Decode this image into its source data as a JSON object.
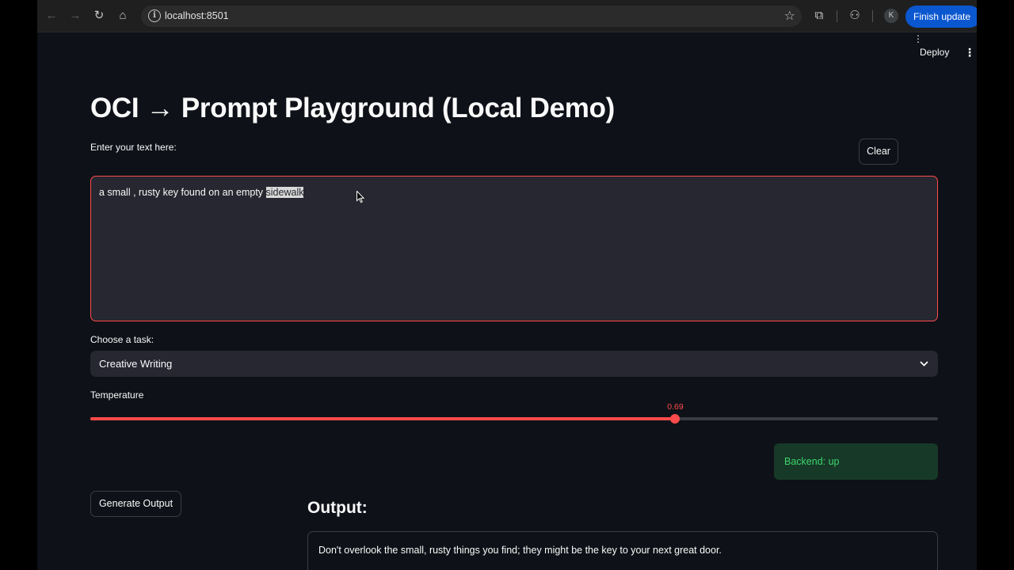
{
  "browser": {
    "url": "localhost:8501",
    "profile_initial": "K",
    "finish_update_label": "Finish update"
  },
  "app": {
    "deploy_label": "Deploy",
    "title": "OCI → Prompt Playground (Local Demo)",
    "input_label": "Enter your text here:",
    "clear_label": "Clear",
    "input_text_before": "a small , rusty key found on an empty ",
    "input_text_selected": "sidewalk",
    "task_label": "Choose a task:",
    "task_selected": "Creative Writing",
    "temperature_label": "Temperature",
    "temperature_value": "0.69",
    "temperature_fraction": 0.69,
    "backend_status": "Backend: up",
    "generate_label": "Generate Output",
    "output_heading": "Output:",
    "output_text": "Don't overlook the small, rusty things you find; they might be the key to your next great door."
  },
  "colors": {
    "accent": "#ff4b4b",
    "background": "#0e1117",
    "input_bg": "#262730",
    "success_text": "#3dd56d",
    "success_bg": "#173928",
    "browser_button": "#0b57d0"
  }
}
